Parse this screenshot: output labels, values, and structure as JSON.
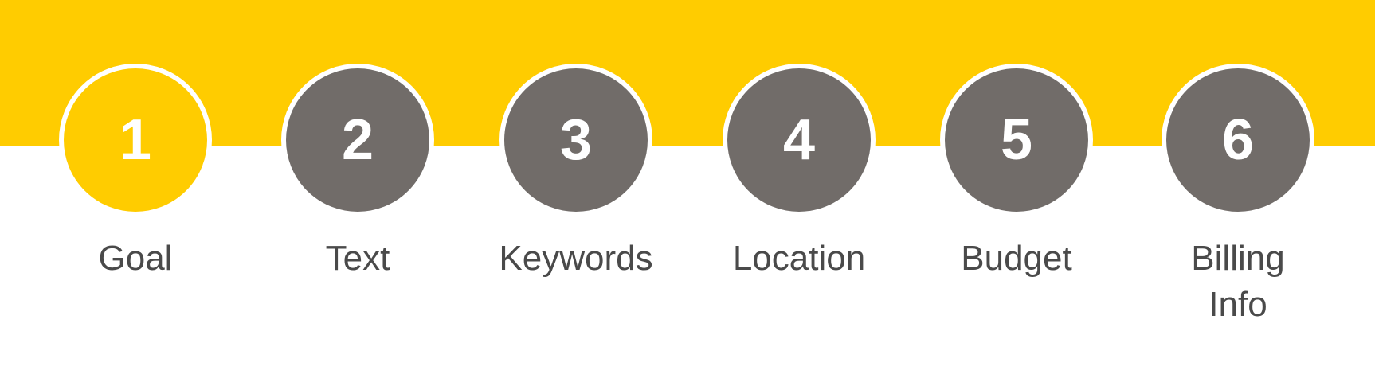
{
  "colors": {
    "accent": "#FFCC00",
    "inactive": "#716C69",
    "label": "#4A4A4A",
    "background": "#FFFFFF",
    "circle_border": "#FFFFFF"
  },
  "current_step": 1,
  "steps": [
    {
      "number": "1",
      "label": "Goal",
      "active": true
    },
    {
      "number": "2",
      "label": "Text",
      "active": false
    },
    {
      "number": "3",
      "label": "Keywords",
      "active": false
    },
    {
      "number": "4",
      "label": "Location",
      "active": false
    },
    {
      "number": "5",
      "label": "Budget",
      "active": false
    },
    {
      "number": "6",
      "label": "Billing Info",
      "active": false
    }
  ]
}
